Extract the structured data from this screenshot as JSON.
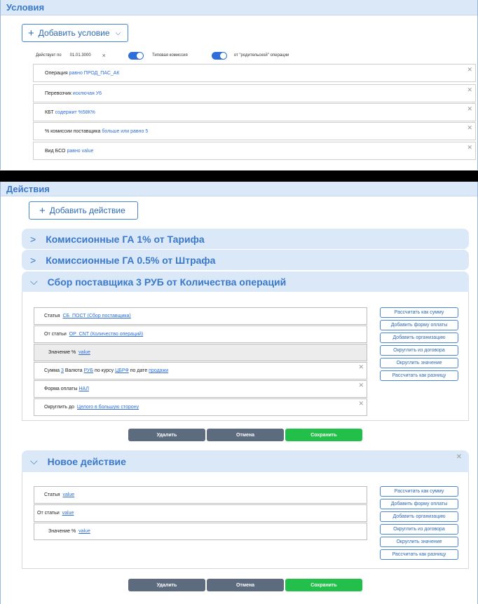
{
  "conditions": {
    "title": "Условия",
    "add_label": "Добавить условие",
    "valid_label": "Действует по",
    "valid_date": "01.01.3000",
    "clear_symbol": "×",
    "typical_label": "Типовая комиссия",
    "parent_label": "от \"родительской\" операции",
    "rows": [
      {
        "field": "Операция",
        "op": "равно",
        "value": "ПРОД_ПАС_АК"
      },
      {
        "field": "Перевозчик",
        "op": "исключая",
        "value": "У6"
      },
      {
        "field": "КБТ",
        "op": "содержит",
        "value": "%58К%"
      },
      {
        "field": "% комиссии поставщика",
        "op": "больше или равно",
        "value": "5"
      },
      {
        "field": "Вид БСО",
        "op": "равно",
        "value": "value"
      }
    ]
  },
  "actions": {
    "title": "Действия",
    "add_label": "Добавить действие",
    "accordions": [
      {
        "title": "Комиссионные ГА 1%  от Тарифа"
      },
      {
        "title": "Комиссионные ГА 0.5%  от Штрафа"
      },
      {
        "title": "Сбор поставщика 3 РУБ от Количества операций"
      },
      {
        "title": "Новое действие"
      }
    ],
    "open_block": {
      "rows": {
        "statya_label": "Статья",
        "statya_value": "СБ_ПОСТ (Сбор поставщика)",
        "ot_label": "От статьи",
        "ot_value": "OP_CNT (Количество операций)",
        "znach_label": "Значение %",
        "znach_value": "value",
        "summa_label": "Сумма",
        "summa_value": "3",
        "valuta_label": "Валюта",
        "valuta_value": "РУБ",
        "kurs_label": "по курсу",
        "kurs_value": "ЦБРФ",
        "date_label": "по дате",
        "date_value": "продажи",
        "forma_label": "Форма оплаты",
        "forma_value": "НАЛ",
        "okrug_label": "Округлить до",
        "okrug_value": "Целого в большую сторону"
      }
    },
    "new_block": {
      "statya_label": "Статья",
      "statya_value": "value",
      "ot_label": "От статьи",
      "ot_value": "value",
      "znach_label": "Значение %",
      "znach_value": "value"
    },
    "side_buttons": [
      "Рассчитать как сумму",
      "Добавить форму оплаты",
      "Добавить организацию",
      "Округлить из договора",
      "Округлить значение",
      "Рассчитать как разницу"
    ],
    "buttons": {
      "delete": "Удалить",
      "cancel": "Отмена",
      "save": "Сохранить"
    }
  },
  "colors": {
    "accent": "#2f6ed9",
    "header_bg": "#dbe8f8",
    "save": "#22c04a",
    "neutral": "#5c6b7e"
  }
}
